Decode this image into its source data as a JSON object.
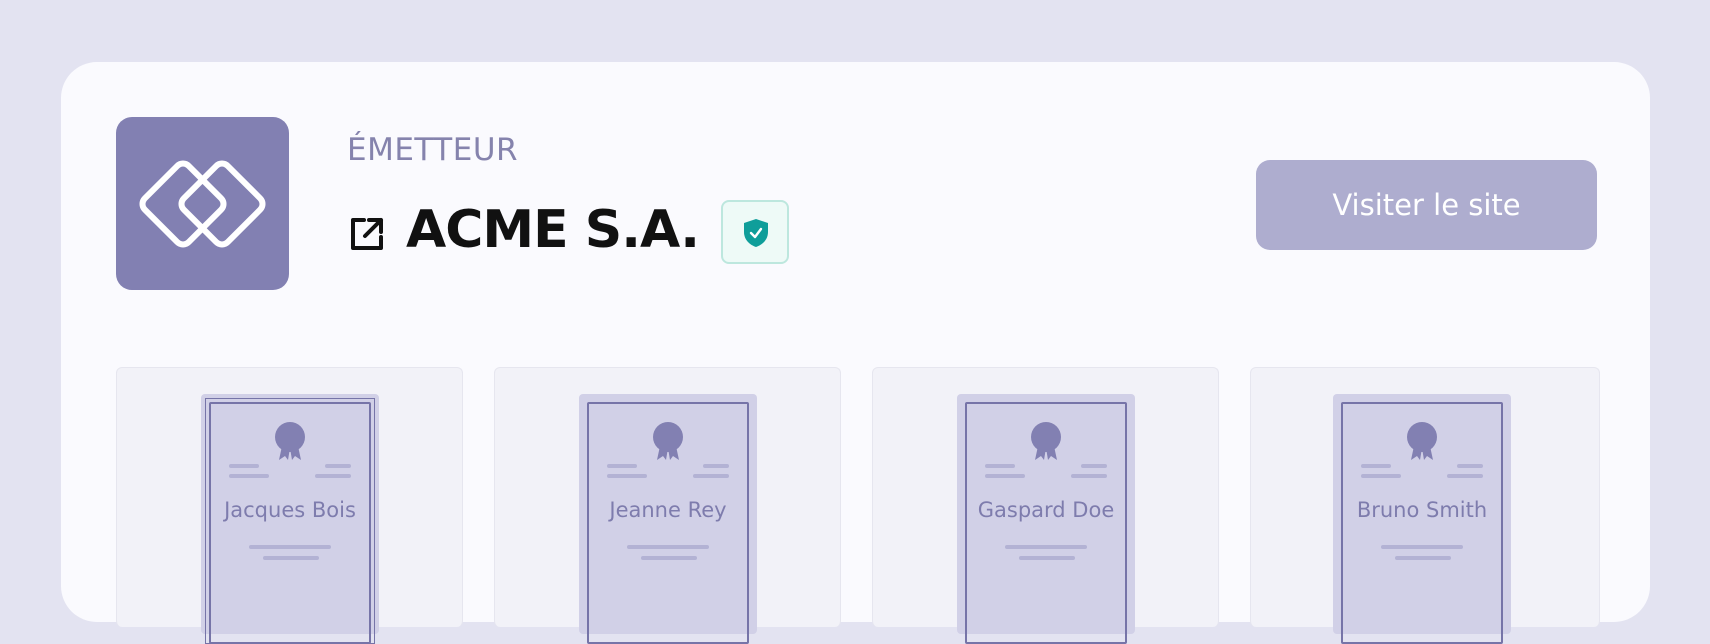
{
  "issuer": {
    "label": "ÉMETTEUR",
    "name": "ACME S.A.",
    "visit_button_label": "Visiter le site",
    "accent_color": "#8280b2",
    "verified_color": "#0f9e9a"
  },
  "certificates": [
    {
      "holder": "Jacques Bois"
    },
    {
      "holder": "Jeanne Rey"
    },
    {
      "holder": "Gaspard Doe"
    },
    {
      "holder": "Bruno Smith"
    }
  ]
}
